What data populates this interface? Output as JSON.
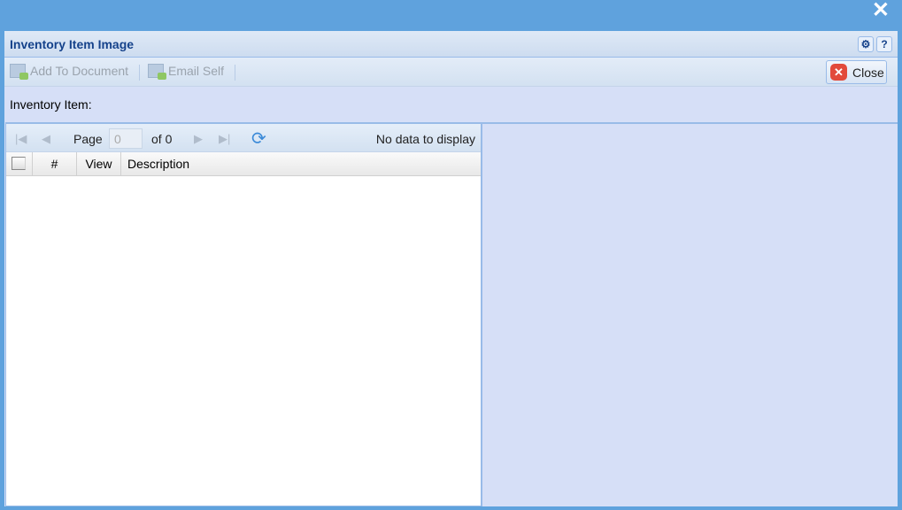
{
  "window": {
    "title": "Inventory Item Image",
    "close_x": "✕",
    "gear": "⚙",
    "help": "?"
  },
  "toolbar": {
    "add": "Add To Document",
    "email": "Email Self",
    "close": "Close"
  },
  "form": {
    "label": "Inventory Item:"
  },
  "pager": {
    "page_label": "Page",
    "page_value": "0",
    "of": "of 0",
    "status": "No data to display"
  },
  "grid": {
    "columns": [
      "#",
      "View",
      "Description"
    ]
  }
}
